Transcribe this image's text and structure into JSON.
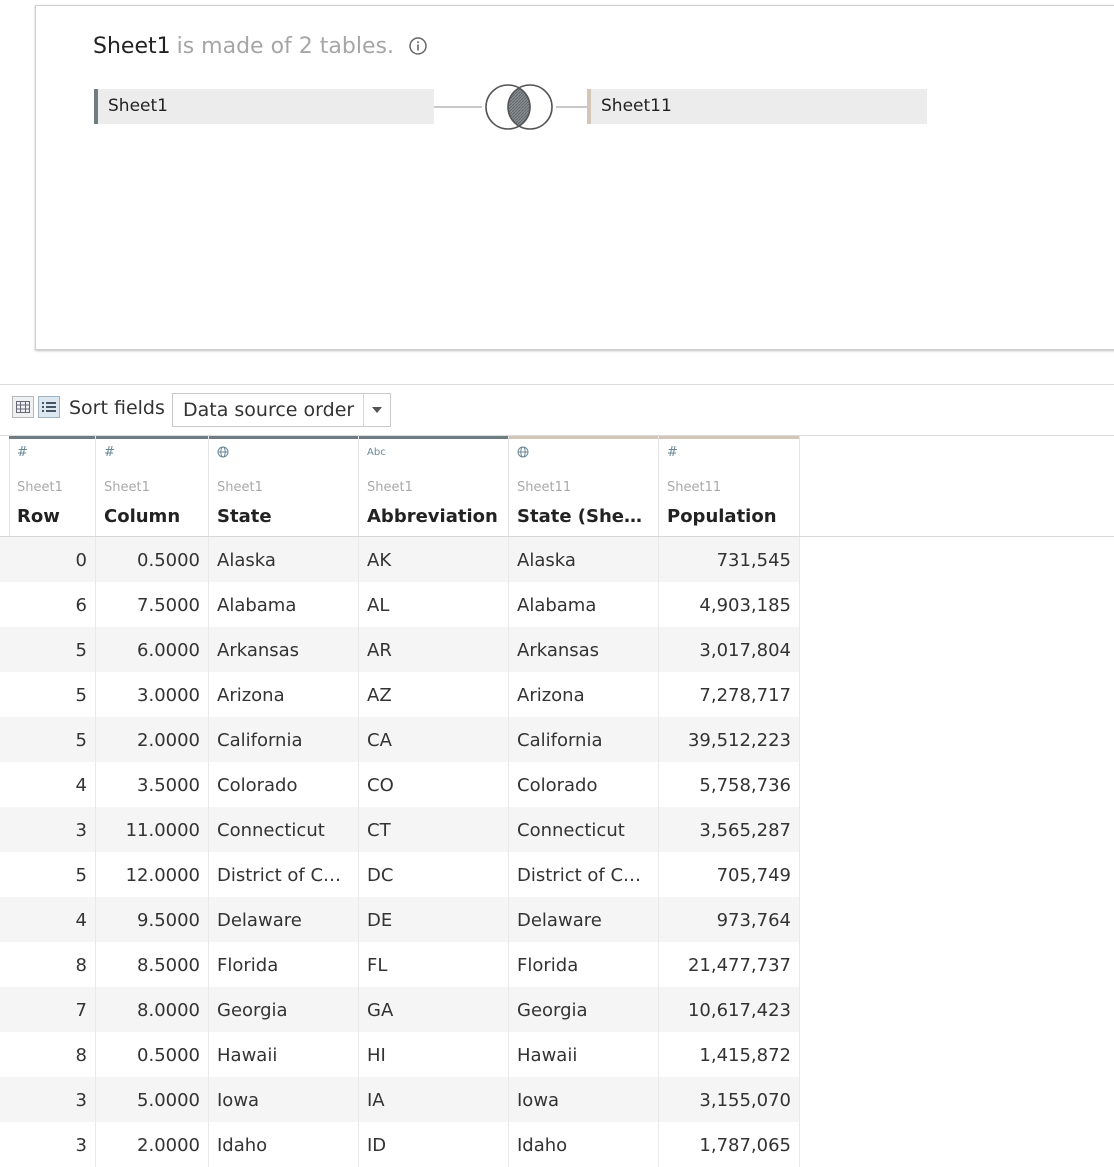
{
  "canvas": {
    "table_name": "Sheet1",
    "description": "is made of 2 tables.",
    "left_table": "Sheet1",
    "right_table": "Sheet11"
  },
  "toolbar": {
    "sort_label": "Sort fields",
    "sort_value": "Data source order"
  },
  "columns": [
    {
      "type_icon": "#",
      "type": "number",
      "source": "Sheet1",
      "name": "Row",
      "accent": "#6f7c82"
    },
    {
      "type_icon": "#",
      "type": "number",
      "source": "Sheet1",
      "name": "Column",
      "accent": "#6f7c82"
    },
    {
      "type_icon": "globe",
      "type": "geo",
      "source": "Sheet1",
      "name": "State",
      "accent": "#6f7c82"
    },
    {
      "type_icon": "Abc",
      "type": "string",
      "source": "Sheet1",
      "name": "Abbreviation",
      "accent": "#6f7c82"
    },
    {
      "type_icon": "globe",
      "type": "geo",
      "source": "Sheet11",
      "name": "State (Shee...",
      "accent": "#d4c6b6"
    },
    {
      "type_icon": "#",
      "type": "number",
      "source": "Sheet11",
      "name": "Population",
      "accent": "#d4c6b6"
    }
  ],
  "rows": [
    [
      "0",
      "0.5000",
      "Alaska",
      "AK",
      "Alaska",
      "731,545"
    ],
    [
      "6",
      "7.5000",
      "Alabama",
      "AL",
      "Alabama",
      "4,903,185"
    ],
    [
      "5",
      "6.0000",
      "Arkansas",
      "AR",
      "Arkansas",
      "3,017,804"
    ],
    [
      "5",
      "3.0000",
      "Arizona",
      "AZ",
      "Arizona",
      "7,278,717"
    ],
    [
      "5",
      "2.0000",
      "California",
      "CA",
      "California",
      "39,512,223"
    ],
    [
      "4",
      "3.5000",
      "Colorado",
      "CO",
      "Colorado",
      "5,758,736"
    ],
    [
      "3",
      "11.0000",
      "Connecticut",
      "CT",
      "Connecticut",
      "3,565,287"
    ],
    [
      "5",
      "12.0000",
      "District of Col...",
      "DC",
      "District of Col...",
      "705,749"
    ],
    [
      "4",
      "9.5000",
      "Delaware",
      "DE",
      "Delaware",
      "973,764"
    ],
    [
      "8",
      "8.5000",
      "Florida",
      "FL",
      "Florida",
      "21,477,737"
    ],
    [
      "7",
      "8.0000",
      "Georgia",
      "GA",
      "Georgia",
      "10,617,423"
    ],
    [
      "8",
      "0.5000",
      "Hawaii",
      "HI",
      "Hawaii",
      "1,415,872"
    ],
    [
      "3",
      "5.0000",
      "Iowa",
      "IA",
      "Iowa",
      "3,155,070"
    ],
    [
      "3",
      "2.0000",
      "Idaho",
      "ID",
      "Idaho",
      "1,787,065"
    ]
  ]
}
